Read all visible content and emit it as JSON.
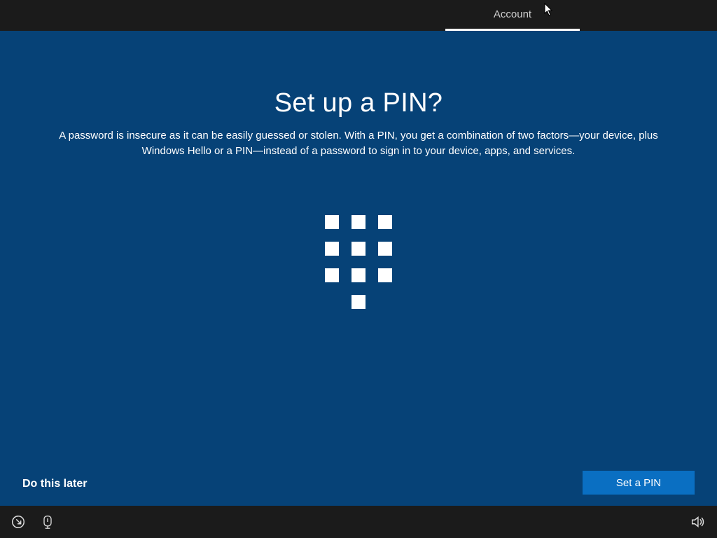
{
  "topbar": {
    "active_tab": "Account"
  },
  "main": {
    "title": "Set up a PIN?",
    "description": "A password is insecure as it can be easily guessed or stolen. With a PIN, you get a combination of two factors—your device, plus Windows Hello or a PIN—instead of a password to sign in to your device, apps, and services."
  },
  "actions": {
    "skip_label": "Do this later",
    "primary_label": "Set a PIN"
  },
  "icons": {
    "ease_of_access": "ease-of-access-icon",
    "ime": "ime-icon",
    "volume": "volume-icon"
  }
}
